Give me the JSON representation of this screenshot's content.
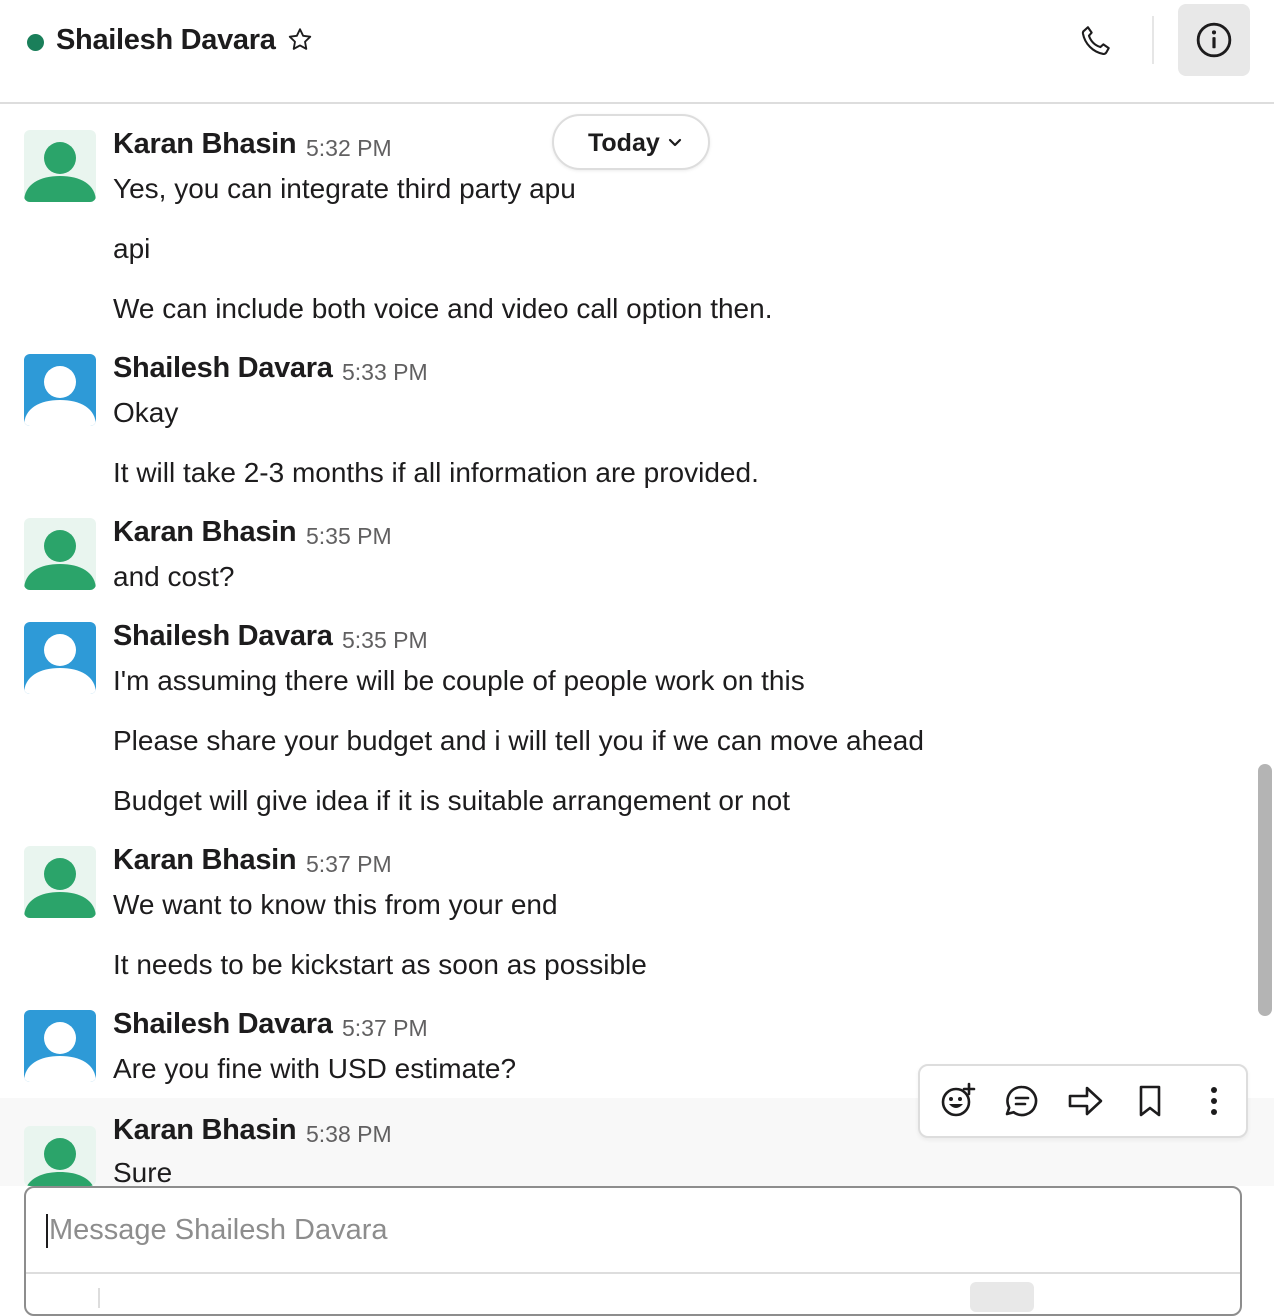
{
  "header": {
    "contact_name": "Shailesh Davara",
    "presence": "active",
    "icons": [
      "star-icon",
      "phone-icon",
      "info-icon"
    ]
  },
  "date_divider": {
    "label": "Today"
  },
  "messages": [
    {
      "sender": "Karan Bhasin",
      "time": "5:32 PM",
      "avatar": "green",
      "lines": [
        "Yes, you can integrate third party apu",
        "api",
        "We can include both voice and video call option then."
      ]
    },
    {
      "sender": "Shailesh Davara",
      "time": "5:33 PM",
      "avatar": "blue",
      "lines": [
        "Okay",
        "It will take 2-3 months if all information are provided."
      ]
    },
    {
      "sender": "Karan Bhasin",
      "time": "5:35 PM",
      "avatar": "green",
      "lines": [
        "and cost?"
      ]
    },
    {
      "sender": "Shailesh Davara",
      "time": "5:35 PM",
      "avatar": "blue",
      "lines": [
        "I'm assuming there will be couple of people work on this",
        "Please share your budget and i will tell you if we can move ahead",
        "Budget will give idea if it is suitable arrangement or not"
      ]
    },
    {
      "sender": "Karan Bhasin",
      "time": "5:37 PM",
      "avatar": "green",
      "lines": [
        "We want to know this from your end",
        "It needs to be kickstart as soon as possible"
      ]
    },
    {
      "sender": "Shailesh Davara",
      "time": "5:37 PM",
      "avatar": "blue",
      "lines": [
        "Are you fine with USD estimate?"
      ]
    },
    {
      "sender": "Karan Bhasin",
      "time": "5:38 PM",
      "avatar": "green",
      "lines": [
        "Sure"
      ]
    }
  ],
  "message_actions": [
    "add-reaction-icon",
    "reply-in-thread-icon",
    "share-message-icon",
    "save-bookmark-icon",
    "more-actions-icon"
  ],
  "composer": {
    "placeholder": "Message Shailesh Davara",
    "value": ""
  },
  "colors": {
    "presence_active": "#1a7f5a",
    "avatar_green": "#2ba46a",
    "avatar_blue": "#2e9ad7"
  }
}
